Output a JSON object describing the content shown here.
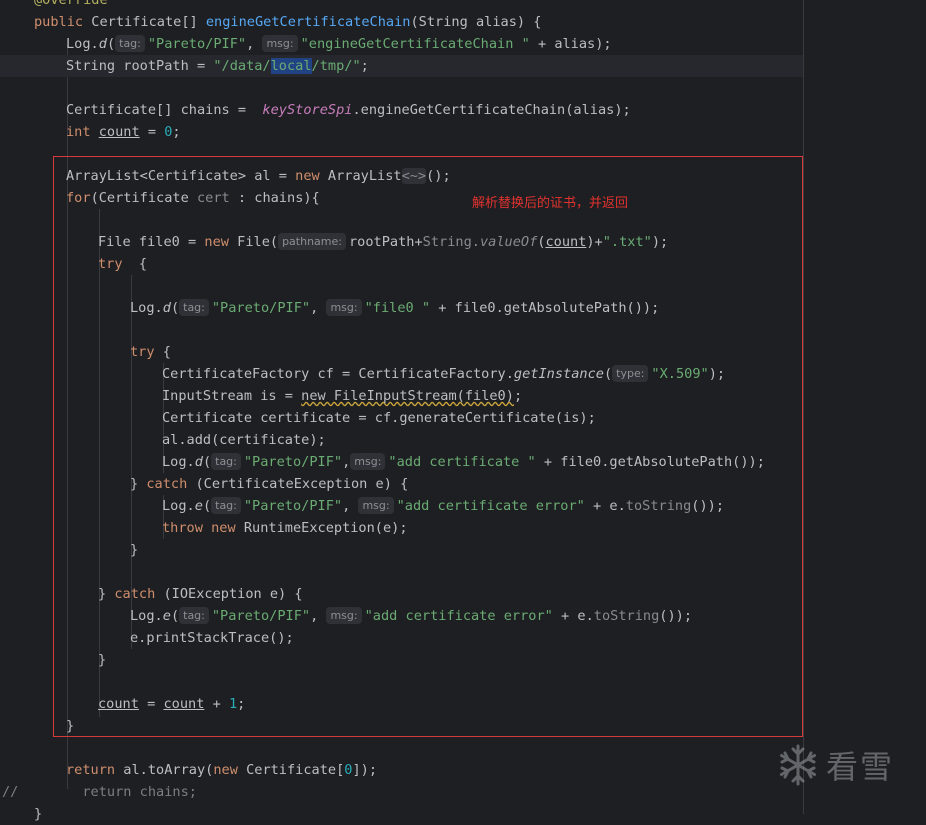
{
  "editor": {
    "annotation": "@Override",
    "comment_marker": "//",
    "inline_note": "解析替换后的证书，并返回",
    "watermark_text": "看雪",
    "colors": {
      "background": "#1e1f22",
      "keyword": "#cf8e6d",
      "string": "#6aab73",
      "number": "#2aacb8",
      "method": "#56a8f5",
      "annotation_box": "#d63a3a",
      "note_text": "#e0322f"
    }
  },
  "hints": {
    "tag": "tag:",
    "msg": "msg:",
    "pathname": "pathname:",
    "type": "type:"
  },
  "code": {
    "l1_kw": "public",
    "l1_a": " Certificate[] ",
    "l1_fn": "engineGetCertificateChain",
    "l1_b": "(String alias) {",
    "l2_a": "Log.",
    "l2_d": "d",
    "l2_b": "(",
    "l2_s1": "\"Pareto/PIF\"",
    "l2_c": ", ",
    "l2_s2": "\"engineGetCertificateChain \"",
    "l2_e": " + alias);",
    "l3_a": "String rootPath = ",
    "l3_s1": "\"/data/",
    "l3_sel": "local",
    "l3_s2": "/tmp/\"",
    "l3_b": ";",
    "l5_a": "Certificate[] chains =  ",
    "l5_fld": "keyStoreSpi",
    "l5_b": ".engineGetCertificateChain(alias);",
    "l6_kw": "int",
    "l6_a": " ",
    "l6_var": "count",
    "l6_b": " = ",
    "l6_n": "0",
    "l6_c": ";",
    "l8_a": "ArrayList<Certificate> al = ",
    "l8_kw": "new",
    "l8_b": " ArrayList",
    "l8_g": "<~>",
    "l8_c": "();",
    "l9_kw": "for",
    "l9_a": "(Certificate ",
    "l9_g": "cert",
    "l9_b": " : chains){",
    "l11_a": "File file0 = ",
    "l11_kw": "new",
    "l11_b": " File(",
    "l11_c": "rootPath+",
    "l11_g1": "String.",
    "l11_g2": "valueOf",
    "l11_d": "(",
    "l11_var": "count",
    "l11_e": ")+",
    "l11_s": "\".txt\"",
    "l11_f": ");",
    "l12_kw": "try",
    "l12_a": "  {",
    "l14_a": "Log.",
    "l14_d": "d",
    "l14_b": "(",
    "l14_s1": "\"Pareto/PIF\"",
    "l14_c": ", ",
    "l14_s2": "\"file0 \"",
    "l14_e": " + file0.getAbsolutePath());",
    "l16_kw": "try",
    "l16_a": " {",
    "l17_a": "CertificateFactory cf = CertificateFactory.",
    "l17_fn": "getInstance",
    "l17_b": "(",
    "l17_s": "\"X.509\"",
    "l17_c": ");",
    "l18_a": "InputStream is = ",
    "l18_w": "new FileInputStream(file0)",
    "l18_b": ";",
    "l19_a": "Certificate certificate = cf.generateCertificate(is);",
    "l20_a": "al.add(certificate);",
    "l21_a": "Log.",
    "l21_d": "d",
    "l21_b": "(",
    "l21_s1": "\"Pareto/PIF\"",
    "l21_c": ",",
    "l21_s2": "\"add certificate \"",
    "l21_e": " + file0.getAbsolutePath());",
    "l22_a": "} ",
    "l22_kw": "catch",
    "l22_b": " (CertificateException e) {",
    "l23_a": "Log.",
    "l23_e": "e",
    "l23_b": "(",
    "l23_s1": "\"Pareto/PIF\"",
    "l23_c": ", ",
    "l23_s2": "\"add certificate error\"",
    "l23_d": " + e.",
    "l23_ts": "toString",
    "l23_f": "());",
    "l24_kw1": "throw",
    "l24_a": " ",
    "l24_kw2": "new",
    "l24_b": " RuntimeException(e);",
    "l25_a": "}",
    "l27_a": "} ",
    "l27_kw": "catch",
    "l27_b": " (IOException e) {",
    "l28_a": "Log.",
    "l28_e": "e",
    "l28_b": "(",
    "l28_s1": "\"Pareto/PIF\"",
    "l28_c": ", ",
    "l28_s2": "\"add certificate error\"",
    "l28_d": " + e.",
    "l28_ts": "toString",
    "l28_f": "());",
    "l29_a": "e.printStackTrace();",
    "l30_a": "}",
    "l32_var1": "count",
    "l32_a": " = ",
    "l32_var2": "count",
    "l32_b": " + ",
    "l32_n": "1",
    "l32_c": ";",
    "l33_a": "}",
    "l35_kw": "return",
    "l35_a": " al.toArray(",
    "l35_kw2": "new",
    "l35_b": " Certificate[",
    "l35_n": "0",
    "l35_c": "]);",
    "l36_a": "  return chains;",
    "l37_a": "}"
  }
}
